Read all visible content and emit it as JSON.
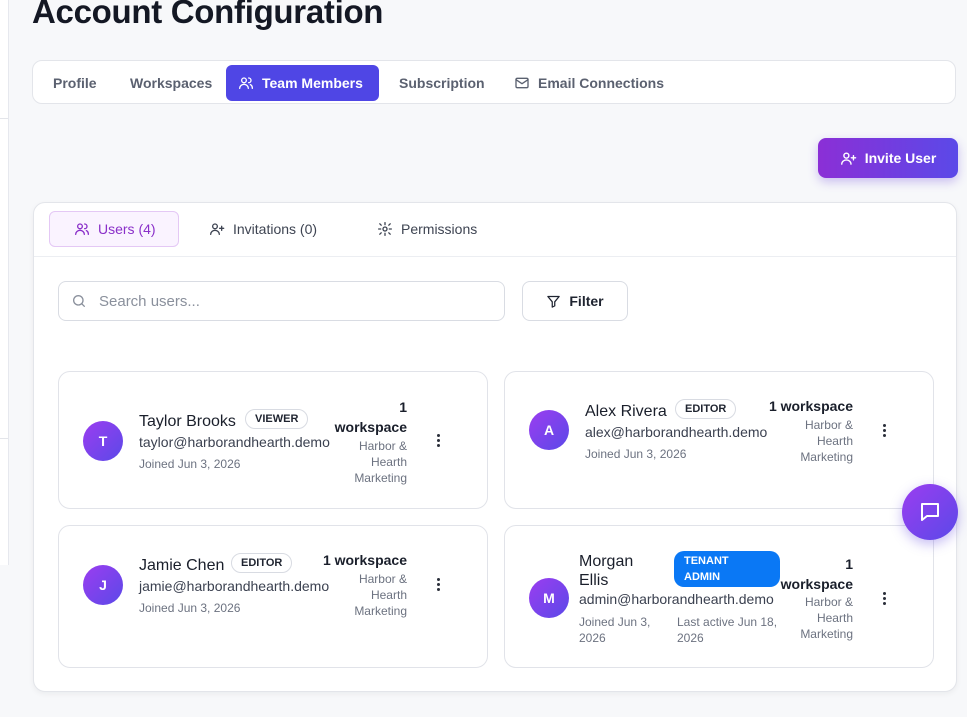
{
  "page": {
    "title": "Account Configuration"
  },
  "tabs": [
    {
      "label": "Profile",
      "icon": ""
    },
    {
      "label": "Workspaces",
      "icon": ""
    },
    {
      "label": "Team Members",
      "icon": "users-icon",
      "active": true
    },
    {
      "label": "Subscription",
      "icon": ""
    },
    {
      "label": "Email Connections",
      "icon": "mail-icon"
    }
  ],
  "invite_button": {
    "label": "Invite User",
    "icon": "user-plus-icon"
  },
  "subtabs": [
    {
      "label": "Users (4)",
      "icon": "users-icon",
      "active": true
    },
    {
      "label": "Invitations (0)",
      "icon": "user-plus-icon"
    },
    {
      "label": "Permissions",
      "icon": "gear-icon"
    }
  ],
  "search": {
    "placeholder": "Search users...",
    "value": ""
  },
  "filter_button": {
    "label": "Filter"
  },
  "users": [
    {
      "initial": "T",
      "name": "Taylor Brooks",
      "role": "VIEWER",
      "email": "taylor@harborandhearth.demo",
      "joined": "Joined Jun 3, 2026",
      "workspace_count_l1": "1",
      "workspace_count_l2": "workspace",
      "workspace_l1": "Harbor &",
      "workspace_l2": "Hearth",
      "workspace_l3": "Marketing"
    },
    {
      "initial": "A",
      "name": "Alex Rivera",
      "role": "EDITOR",
      "email": "alex@harborandhearth.demo",
      "joined": "Joined Jun 3, 2026",
      "workspace_count": "1 workspace",
      "workspace_l1": "Harbor &",
      "workspace_l2": "Hearth",
      "workspace_l3": "Marketing"
    },
    {
      "initial": "J",
      "name": "Jamie Chen",
      "role": "EDITOR",
      "email": "jamie@harborandhearth.demo",
      "joined": "Joined Jun 3, 2026",
      "workspace_count": "1 workspace",
      "workspace_l1": "Harbor &",
      "workspace_l2": "Hearth",
      "workspace_l3": "Marketing"
    },
    {
      "initial": "M",
      "name_l1": "Morgan",
      "name_l2": "Ellis",
      "role_l1": "TENANT",
      "role_l2": "ADMIN",
      "email": "admin@harborandhearth.demo",
      "joined_l1": "Joined Jun 3,",
      "joined_l2": "2026",
      "last_active_l1": "Last active Jun 18,",
      "last_active_l2": "2026",
      "workspace_count_l1": "1",
      "workspace_count_l2": "workspace",
      "workspace_l1": "Harbor &",
      "workspace_l2": "Hearth",
      "workspace_l3": "Marketing"
    }
  ],
  "colors": {
    "primary": "#4f46e5",
    "accent_purple": "#8b2fd6",
    "tenant_badge": "#0a78f5"
  }
}
